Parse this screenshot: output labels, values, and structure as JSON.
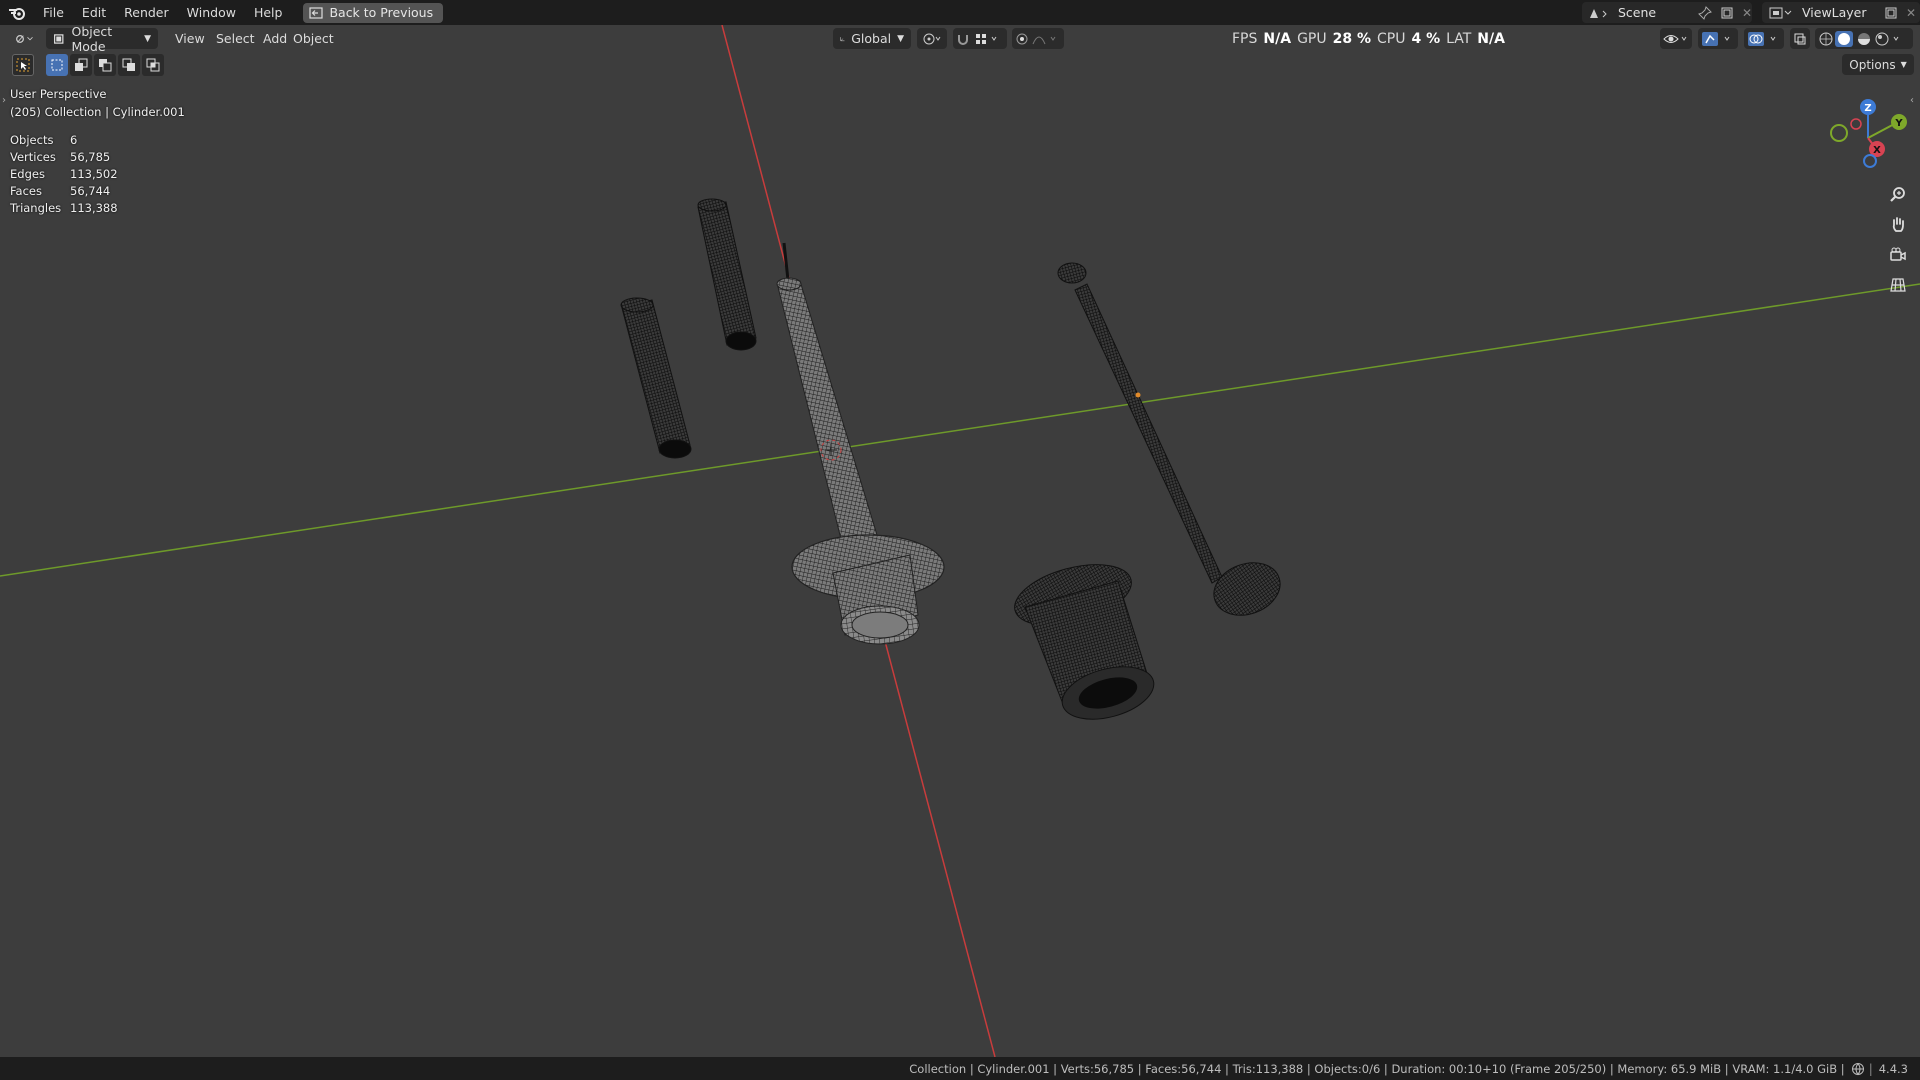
{
  "menubar": {
    "items": [
      "File",
      "Edit",
      "Render",
      "Window",
      "Help"
    ],
    "back_button": "Back to Previous",
    "scene": "Scene",
    "view_layer": "ViewLayer"
  },
  "viewport_header": {
    "mode": "Object Mode",
    "menus": [
      "View",
      "Select",
      "Add",
      "Object"
    ],
    "transform_orientation": "Global",
    "options": "Options"
  },
  "performance": {
    "fps_label": "FPS",
    "fps_value": "N/A",
    "gpu_label": "GPU",
    "gpu_value": "28 %",
    "cpu_label": "CPU",
    "cpu_value": "4 %",
    "lat_label": "LAT",
    "lat_value": "N/A"
  },
  "overlay": {
    "view_name": "User Perspective",
    "context": "(205) Collection | Cylinder.001"
  },
  "stats": [
    {
      "label": "Objects",
      "value": "6"
    },
    {
      "label": "Vertices",
      "value": "56,785"
    },
    {
      "label": "Edges",
      "value": "113,502"
    },
    {
      "label": "Faces",
      "value": "56,744"
    },
    {
      "label": "Triangles",
      "value": "113,388"
    }
  ],
  "gizmo": {
    "x": "X",
    "y": "Y",
    "z": "Z"
  },
  "statusbar": {
    "text": "Collection | Cylinder.001 | Verts:56,785 | Faces:56,744 | Tris:113,388 | Objects:0/6 | Duration: 00:10+10 (Frame 205/250) | Memory: 65.9 MiB | VRAM: 1.1/4.0 GiB |",
    "version": "4.4.3"
  },
  "colors": {
    "viewport_bg": "#3d3d3d",
    "x_axis": "#c83c3c",
    "y_axis": "#6e9a2a",
    "accent": "#4772b3"
  }
}
